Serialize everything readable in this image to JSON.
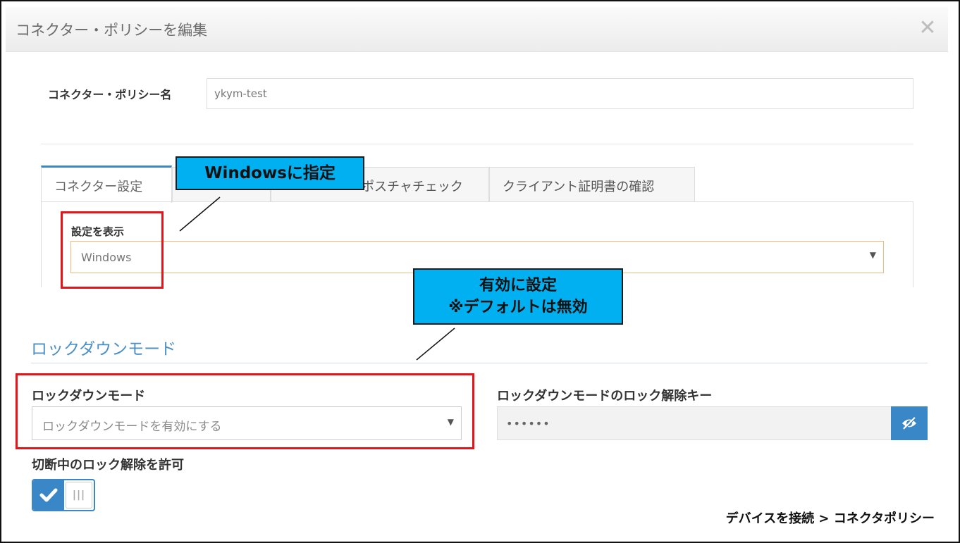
{
  "modal": {
    "title": "コネクター・ポリシーを編集",
    "close": "✕"
  },
  "policy_name": {
    "label": "コネクター・ポリシー名",
    "value": "ykym-test"
  },
  "tabs": [
    {
      "label": "コネクター設定"
    },
    {
      "label": "ポスチャチェック"
    },
    {
      "label": "クライアント証明書の確認"
    }
  ],
  "settings_panel": {
    "label": "設定を表示",
    "selected": "Windows"
  },
  "lockdown": {
    "section_title": "ロックダウンモード",
    "mode_label": "ロックダウンモード",
    "mode_selected": "ロックダウンモードを有効にする",
    "unlock_key_label": "ロックダウンモードのロック解除キー",
    "unlock_key_value": "••••••",
    "allow_unlock_label": "切断中のロック解除を許可"
  },
  "callouts": {
    "windows": "Windowsに指定",
    "enable_line1": "有効に設定",
    "enable_line2": "※デフォルトは無効"
  },
  "breadcrumb": "デバイスを接続 > コネクタポリシー",
  "colors": {
    "accent": "#3a87c8",
    "callout": "#00b0f0",
    "highlight": "#e3151b"
  }
}
